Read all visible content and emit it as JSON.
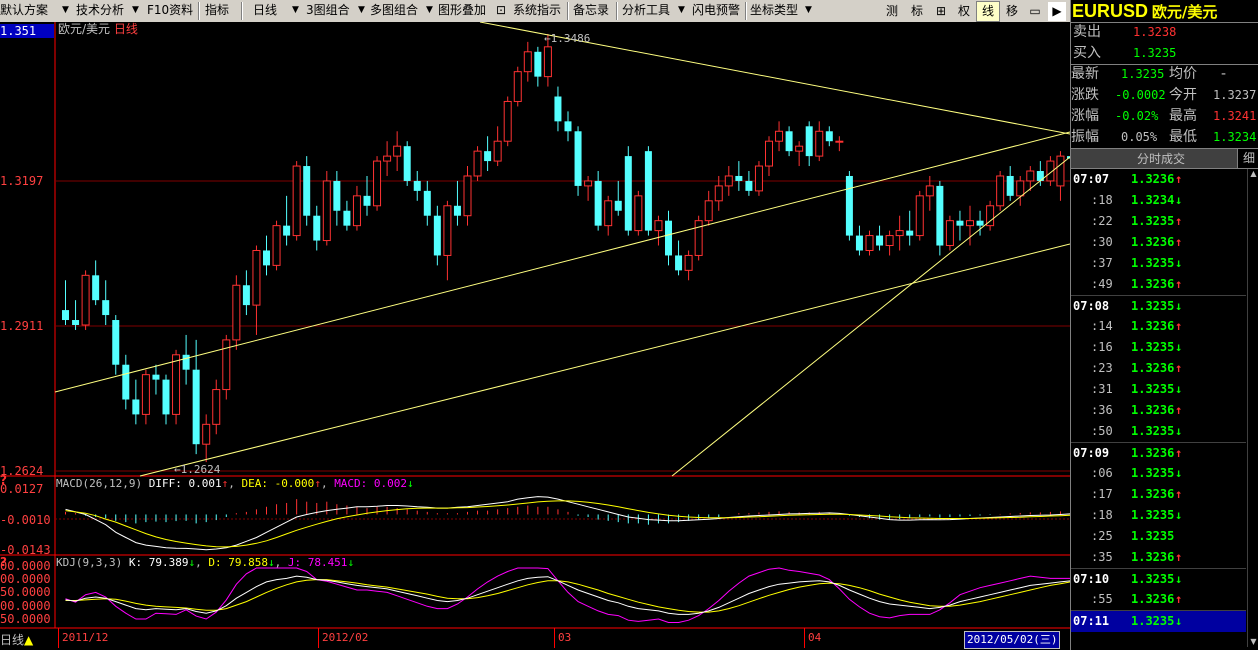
{
  "toolbar": {
    "items": [
      "默认方案",
      "技术分析",
      "F10资料",
      "指标",
      "日线",
      "3图组合",
      "多图组合",
      "图形叠加",
      "系统指示",
      "备忘录",
      "分析工具",
      "闪电预警",
      "坐标类型"
    ],
    "right_buttons": [
      "测",
      "标",
      "⊞",
      "权",
      "线",
      "移",
      "▭"
    ],
    "active_right": "线"
  },
  "chart": {
    "title": "欧元/美元",
    "period": "日线",
    "current_price_label": "1.351",
    "price_axis": [
      "1.3197",
      "1.2911",
      "1.2624"
    ],
    "high_annotation": "1.3486",
    "low_annotation": "1.2624",
    "macd_header": {
      "name": "MACD(26,12,9)",
      "diff": "DIFF: 0.001",
      "dea": "DEA: -0.000",
      "macd": "MACD: 0.002"
    },
    "macd_axis": [
      "0.0127",
      "-0.0010",
      "-0.0143"
    ],
    "kdj_header": {
      "name": "KDJ(9,3,3)",
      "k": "K: 79.389",
      "d": "D: 79.858",
      "j": "J: 78.451"
    },
    "kdj_axis": [
      "00.0000",
      "00.0000",
      "50.0000",
      "00.0000",
      "50.0000"
    ],
    "bottom_label": "日线",
    "date_labels": [
      "2011/12",
      "2012/02",
      "03",
      "04"
    ],
    "cursor_date": "2012/05/02(三)"
  },
  "quote": {
    "symbol": "EURUSD",
    "name": "欧元/美元",
    "sell_label": "卖出",
    "sell": "1.3238",
    "buy_label": "买入",
    "buy": "1.3235",
    "last_label": "最新",
    "last": "1.3235",
    "avg_label": "均价",
    "avg": "-",
    "chg_label": "涨跌",
    "chg": "-0.0002",
    "open_label": "今开",
    "open": "1.3237",
    "pct_label": "涨幅",
    "pct": "-0.02%",
    "high_label": "最高",
    "high": "1.3241",
    "amp_label": "振幅",
    "amp": "0.05%",
    "low_label": "最低",
    "low": "1.3234",
    "ticks_title": "分时成交",
    "detail_tab": "细",
    "ticks": [
      {
        "t": "07:07",
        "p": "1.3236",
        "d": "up"
      },
      {
        "t": ":18",
        "p": "1.3234",
        "d": "down"
      },
      {
        "t": ":22",
        "p": "1.3235",
        "d": "up"
      },
      {
        "t": ":30",
        "p": "1.3236",
        "d": "up"
      },
      {
        "t": ":37",
        "p": "1.3235",
        "d": "down"
      },
      {
        "t": ":49",
        "p": "1.3236",
        "d": "up"
      },
      {
        "t": "07:08",
        "p": "1.3235",
        "d": "down"
      },
      {
        "t": ":14",
        "p": "1.3236",
        "d": "up"
      },
      {
        "t": ":16",
        "p": "1.3235",
        "d": "down"
      },
      {
        "t": ":23",
        "p": "1.3236",
        "d": "up"
      },
      {
        "t": ":31",
        "p": "1.3235",
        "d": "down"
      },
      {
        "t": ":36",
        "p": "1.3236",
        "d": "up"
      },
      {
        "t": ":50",
        "p": "1.3235",
        "d": "down"
      },
      {
        "t": "07:09",
        "p": "1.3236",
        "d": "up"
      },
      {
        "t": ":06",
        "p": "1.3235",
        "d": "down"
      },
      {
        "t": ":17",
        "p": "1.3236",
        "d": "up"
      },
      {
        "t": ":18",
        "p": "1.3235",
        "d": "down"
      },
      {
        "t": ":25",
        "p": "1.3235",
        "d": ""
      },
      {
        "t": ":35",
        "p": "1.3236",
        "d": "up"
      },
      {
        "t": "07:10",
        "p": "1.3235",
        "d": "down"
      },
      {
        "t": ":55",
        "p": "1.3236",
        "d": "up"
      },
      {
        "t": "07:11",
        "p": "1.3235",
        "d": "down"
      }
    ]
  },
  "colors": {
    "up": "#ff3232",
    "down": "#54ffff",
    "text_green": "#00ff00",
    "axis_red": "#ff4040",
    "trend": "#ffff80",
    "diff": "#ffffff",
    "dea": "#ffff00",
    "macdc": "#ff00ff"
  },
  "candles": [
    {
      "o": 1.293,
      "h": 1.299,
      "l": 1.29,
      "c": 1.291
    },
    {
      "o": 1.291,
      "h": 1.295,
      "l": 1.289,
      "c": 1.29
    },
    {
      "o": 1.29,
      "h": 1.301,
      "l": 1.289,
      "c": 1.3
    },
    {
      "o": 1.3,
      "h": 1.303,
      "l": 1.294,
      "c": 1.295
    },
    {
      "o": 1.295,
      "h": 1.299,
      "l": 1.29,
      "c": 1.292
    },
    {
      "o": 1.291,
      "h": 1.292,
      "l": 1.28,
      "c": 1.282
    },
    {
      "o": 1.282,
      "h": 1.284,
      "l": 1.273,
      "c": 1.275
    },
    {
      "o": 1.275,
      "h": 1.279,
      "l": 1.27,
      "c": 1.272
    },
    {
      "o": 1.272,
      "h": 1.281,
      "l": 1.27,
      "c": 1.28
    },
    {
      "o": 1.28,
      "h": 1.282,
      "l": 1.276,
      "c": 1.279
    },
    {
      "o": 1.279,
      "h": 1.28,
      "l": 1.27,
      "c": 1.272
    },
    {
      "o": 1.272,
      "h": 1.285,
      "l": 1.27,
      "c": 1.284
    },
    {
      "o": 1.284,
      "h": 1.288,
      "l": 1.278,
      "c": 1.281
    },
    {
      "o": 1.281,
      "h": 1.287,
      "l": 1.264,
      "c": 1.266
    },
    {
      "o": 1.266,
      "h": 1.272,
      "l": 1.2624,
      "c": 1.27
    },
    {
      "o": 1.27,
      "h": 1.279,
      "l": 1.268,
      "c": 1.277
    },
    {
      "o": 1.277,
      "h": 1.288,
      "l": 1.275,
      "c": 1.287
    },
    {
      "o": 1.287,
      "h": 1.3,
      "l": 1.285,
      "c": 1.298
    },
    {
      "o": 1.298,
      "h": 1.301,
      "l": 1.292,
      "c": 1.294
    },
    {
      "o": 1.294,
      "h": 1.306,
      "l": 1.288,
      "c": 1.305
    },
    {
      "o": 1.305,
      "h": 1.308,
      "l": 1.3,
      "c": 1.302
    },
    {
      "o": 1.302,
      "h": 1.311,
      "l": 1.301,
      "c": 1.31
    },
    {
      "o": 1.31,
      "h": 1.316,
      "l": 1.306,
      "c": 1.308
    },
    {
      "o": 1.308,
      "h": 1.323,
      "l": 1.307,
      "c": 1.322
    },
    {
      "o": 1.322,
      "h": 1.324,
      "l": 1.31,
      "c": 1.312
    },
    {
      "o": 1.312,
      "h": 1.314,
      "l": 1.305,
      "c": 1.307
    },
    {
      "o": 1.307,
      "h": 1.321,
      "l": 1.306,
      "c": 1.319
    },
    {
      "o": 1.319,
      "h": 1.321,
      "l": 1.31,
      "c": 1.313
    },
    {
      "o": 1.313,
      "h": 1.315,
      "l": 1.309,
      "c": 1.31
    },
    {
      "o": 1.31,
      "h": 1.318,
      "l": 1.309,
      "c": 1.316
    },
    {
      "o": 1.316,
      "h": 1.32,
      "l": 1.312,
      "c": 1.314
    },
    {
      "o": 1.314,
      "h": 1.324,
      "l": 1.313,
      "c": 1.323
    },
    {
      "o": 1.323,
      "h": 1.327,
      "l": 1.32,
      "c": 1.324
    },
    {
      "o": 1.324,
      "h": 1.329,
      "l": 1.321,
      "c": 1.326
    },
    {
      "o": 1.326,
      "h": 1.327,
      "l": 1.318,
      "c": 1.319
    },
    {
      "o": 1.319,
      "h": 1.321,
      "l": 1.315,
      "c": 1.317
    },
    {
      "o": 1.317,
      "h": 1.319,
      "l": 1.31,
      "c": 1.312
    },
    {
      "o": 1.312,
      "h": 1.314,
      "l": 1.302,
      "c": 1.304
    },
    {
      "o": 1.304,
      "h": 1.315,
      "l": 1.299,
      "c": 1.314
    },
    {
      "o": 1.314,
      "h": 1.319,
      "l": 1.31,
      "c": 1.312
    },
    {
      "o": 1.312,
      "h": 1.322,
      "l": 1.31,
      "c": 1.32
    },
    {
      "o": 1.32,
      "h": 1.326,
      "l": 1.319,
      "c": 1.325
    },
    {
      "o": 1.325,
      "h": 1.328,
      "l": 1.321,
      "c": 1.323
    },
    {
      "o": 1.323,
      "h": 1.33,
      "l": 1.322,
      "c": 1.327
    },
    {
      "o": 1.327,
      "h": 1.336,
      "l": 1.326,
      "c": 1.335
    },
    {
      "o": 1.335,
      "h": 1.342,
      "l": 1.334,
      "c": 1.341
    },
    {
      "o": 1.341,
      "h": 1.347,
      "l": 1.339,
      "c": 1.345
    },
    {
      "o": 1.345,
      "h": 1.346,
      "l": 1.338,
      "c": 1.34
    },
    {
      "o": 1.34,
      "h": 1.3486,
      "l": 1.338,
      "c": 1.346
    },
    {
      "o": 1.336,
      "h": 1.338,
      "l": 1.329,
      "c": 1.331
    },
    {
      "o": 1.331,
      "h": 1.333,
      "l": 1.327,
      "c": 1.329
    },
    {
      "o": 1.329,
      "h": 1.33,
      "l": 1.316,
      "c": 1.318
    },
    {
      "o": 1.318,
      "h": 1.32,
      "l": 1.315,
      "c": 1.319
    },
    {
      "o": 1.319,
      "h": 1.321,
      "l": 1.309,
      "c": 1.31
    },
    {
      "o": 1.31,
      "h": 1.316,
      "l": 1.308,
      "c": 1.315
    },
    {
      "o": 1.315,
      "h": 1.319,
      "l": 1.312,
      "c": 1.313
    },
    {
      "o": 1.324,
      "h": 1.326,
      "l": 1.308,
      "c": 1.309
    },
    {
      "o": 1.309,
      "h": 1.317,
      "l": 1.308,
      "c": 1.316
    },
    {
      "o": 1.325,
      "h": 1.326,
      "l": 1.308,
      "c": 1.309
    },
    {
      "o": 1.309,
      "h": 1.312,
      "l": 1.306,
      "c": 1.311
    },
    {
      "o": 1.311,
      "h": 1.313,
      "l": 1.302,
      "c": 1.304
    },
    {
      "o": 1.304,
      "h": 1.307,
      "l": 1.3,
      "c": 1.301
    },
    {
      "o": 1.301,
      "h": 1.305,
      "l": 1.299,
      "c": 1.304
    },
    {
      "o": 1.304,
      "h": 1.312,
      "l": 1.303,
      "c": 1.311
    },
    {
      "o": 1.311,
      "h": 1.317,
      "l": 1.31,
      "c": 1.315
    },
    {
      "o": 1.315,
      "h": 1.32,
      "l": 1.313,
      "c": 1.318
    },
    {
      "o": 1.318,
      "h": 1.322,
      "l": 1.316,
      "c": 1.32
    },
    {
      "o": 1.32,
      "h": 1.323,
      "l": 1.317,
      "c": 1.319
    },
    {
      "o": 1.319,
      "h": 1.321,
      "l": 1.316,
      "c": 1.317
    },
    {
      "o": 1.317,
      "h": 1.323,
      "l": 1.316,
      "c": 1.322
    },
    {
      "o": 1.322,
      "h": 1.328,
      "l": 1.32,
      "c": 1.327
    },
    {
      "o": 1.327,
      "h": 1.331,
      "l": 1.325,
      "c": 1.329
    },
    {
      "o": 1.329,
      "h": 1.33,
      "l": 1.324,
      "c": 1.325
    },
    {
      "o": 1.325,
      "h": 1.327,
      "l": 1.322,
      "c": 1.326
    },
    {
      "o": 1.33,
      "h": 1.331,
      "l": 1.322,
      "c": 1.324
    },
    {
      "o": 1.324,
      "h": 1.331,
      "l": 1.323,
      "c": 1.329
    },
    {
      "o": 1.329,
      "h": 1.33,
      "l": 1.326,
      "c": 1.327
    },
    {
      "o": 1.327,
      "h": 1.328,
      "l": 1.325,
      "c": 1.327
    },
    {
      "o": 1.32,
      "h": 1.321,
      "l": 1.307,
      "c": 1.308
    },
    {
      "o": 1.308,
      "h": 1.31,
      "l": 1.304,
      "c": 1.305
    },
    {
      "o": 1.305,
      "h": 1.309,
      "l": 1.304,
      "c": 1.308
    },
    {
      "o": 1.308,
      "h": 1.31,
      "l": 1.305,
      "c": 1.306
    },
    {
      "o": 1.306,
      "h": 1.309,
      "l": 1.304,
      "c": 1.308
    },
    {
      "o": 1.308,
      "h": 1.312,
      "l": 1.305,
      "c": 1.309
    },
    {
      "o": 1.309,
      "h": 1.313,
      "l": 1.306,
      "c": 1.308
    },
    {
      "o": 1.308,
      "h": 1.317,
      "l": 1.307,
      "c": 1.316
    },
    {
      "o": 1.316,
      "h": 1.32,
      "l": 1.313,
      "c": 1.318
    },
    {
      "o": 1.318,
      "h": 1.319,
      "l": 1.304,
      "c": 1.306
    },
    {
      "o": 1.306,
      "h": 1.312,
      "l": 1.305,
      "c": 1.311
    },
    {
      "o": 1.311,
      "h": 1.313,
      "l": 1.307,
      "c": 1.31
    },
    {
      "o": 1.31,
      "h": 1.314,
      "l": 1.306,
      "c": 1.311
    },
    {
      "o": 1.311,
      "h": 1.313,
      "l": 1.308,
      "c": 1.31
    },
    {
      "o": 1.31,
      "h": 1.315,
      "l": 1.309,
      "c": 1.314
    },
    {
      "o": 1.314,
      "h": 1.321,
      "l": 1.313,
      "c": 1.32
    },
    {
      "o": 1.32,
      "h": 1.322,
      "l": 1.315,
      "c": 1.316
    },
    {
      "o": 1.316,
      "h": 1.32,
      "l": 1.314,
      "c": 1.319
    },
    {
      "o": 1.319,
      "h": 1.322,
      "l": 1.317,
      "c": 1.321
    },
    {
      "o": 1.321,
      "h": 1.323,
      "l": 1.318,
      "c": 1.319
    },
    {
      "o": 1.319,
      "h": 1.324,
      "l": 1.318,
      "c": 1.323
    },
    {
      "o": 1.318,
      "h": 1.325,
      "l": 1.315,
      "c": 1.324
    },
    {
      "o": 1.324,
      "h": 1.326,
      "l": 1.322,
      "c": 1.3235
    },
    {
      "o": 1.3235,
      "h": 1.326,
      "l": 1.32,
      "c": 1.3236
    },
    {
      "o": 1.3236,
      "h": 1.3241,
      "l": 1.3234,
      "c": 1.3235
    }
  ],
  "macd_hist": [
    0.001,
    0.0005,
    -0.0005,
    -0.001,
    -0.0015,
    -0.0025,
    -0.003,
    -0.0035,
    -0.003,
    -0.0028,
    -0.003,
    -0.0026,
    -0.0025,
    -0.0035,
    -0.003,
    -0.0022,
    -0.001,
    0.0005,
    0.001,
    0.002,
    0.003,
    0.004,
    0.0045,
    0.006,
    0.005,
    0.0045,
    0.005,
    0.004,
    0.0035,
    0.003,
    0.0025,
    0.003,
    0.003,
    0.0025,
    0.002,
    0.0015,
    0.001,
    0.0005,
    0.0005,
    0.0005,
    0.001,
    0.0015,
    0.0015,
    0.002,
    0.0025,
    0.003,
    0.0035,
    0.003,
    0.003,
    0.002,
    0.001,
    -0.0005,
    -0.001,
    -0.002,
    -0.0025,
    -0.003,
    -0.0035,
    -0.0035,
    -0.004,
    -0.0035,
    -0.0035,
    -0.003,
    -0.0025,
    -0.002,
    -0.0015,
    -0.001,
    0.0,
    0.0005,
    0.0005,
    0.0008,
    0.001,
    0.0012,
    0.001,
    0.0008,
    0.0008,
    0.001,
    0.0008,
    0.0005,
    -0.0005,
    -0.001,
    -0.0015,
    -0.002,
    -0.002,
    -0.0018,
    -0.0015,
    -0.001,
    -0.0008,
    -0.0012,
    -0.001,
    -0.0008,
    -0.0006,
    -0.0004,
    -0.0002,
    0.0002,
    0.0004,
    0.0006,
    0.0008,
    0.0008,
    0.001,
    0.0012,
    0.0012,
    0.0015,
    0.0014
  ],
  "macd_diff": [
    0.002,
    0.001,
    0.0,
    -0.002,
    -0.004,
    -0.007,
    -0.009,
    -0.011,
    -0.012,
    -0.0125,
    -0.013,
    -0.0132,
    -0.0133,
    -0.0135,
    -0.0138,
    -0.0135,
    -0.013,
    -0.012,
    -0.0105,
    -0.009,
    -0.007,
    -0.005,
    -0.003,
    -0.001,
    0.0,
    0.0008,
    0.0015,
    0.002,
    0.0025,
    0.003,
    0.003,
    0.0032,
    0.0035,
    0.0035,
    0.0033,
    0.003,
    0.0028,
    0.0025,
    0.0025,
    0.0028,
    0.003,
    0.0035,
    0.004,
    0.0045,
    0.005,
    0.006,
    0.0065,
    0.007,
    0.0068,
    0.006,
    0.005,
    0.004,
    0.003,
    0.002,
    0.001,
    0.0,
    -0.001,
    -0.0015,
    -0.002,
    -0.0022,
    -0.0025,
    -0.0025,
    -0.0023,
    -0.0021,
    -0.0019,
    -0.0016,
    -0.0012,
    -0.0009,
    -0.0006,
    -0.0004,
    -0.0002,
    0.0,
    0.0002,
    0.0003,
    0.0004,
    0.0005,
    0.0006,
    0.0004,
    0.0,
    -0.0005,
    -0.001,
    -0.0015,
    -0.002,
    -0.0022,
    -0.0022,
    -0.0021,
    -0.002,
    -0.0021,
    -0.002,
    -0.0018,
    -0.0016,
    -0.0014,
    -0.0012,
    -0.001,
    -0.0008,
    -0.0006,
    -0.0004,
    -0.0003,
    -0.0002,
    0.0,
    0.0002,
    0.0005,
    0.0008
  ],
  "macd_dea": [
    0.0015,
    0.001,
    0.0005,
    -0.0005,
    -0.0018,
    -0.003,
    -0.0045,
    -0.006,
    -0.0075,
    -0.0088,
    -0.0098,
    -0.0106,
    -0.0112,
    -0.0118,
    -0.0123,
    -0.0126,
    -0.0127,
    -0.0125,
    -0.012,
    -0.0113,
    -0.0103,
    -0.009,
    -0.0076,
    -0.0062,
    -0.005,
    -0.0038,
    -0.0027,
    -0.0017,
    -0.0009,
    -0.0002,
    0.0005,
    0.001,
    0.0015,
    0.0019,
    0.0022,
    0.0024,
    0.0025,
    0.0025,
    0.0025,
    0.0026,
    0.0027,
    0.0029,
    0.0031,
    0.0034,
    0.0037,
    0.0041,
    0.0045,
    0.0049,
    0.0052,
    0.0053,
    0.0053,
    0.0051,
    0.0048,
    0.0043,
    0.0037,
    0.003,
    0.0022,
    0.0015,
    0.0008,
    0.0002,
    -0.0003,
    -0.0007,
    -0.001,
    -0.0012,
    -0.0013,
    -0.0013,
    -0.0013,
    -0.0012,
    -0.001,
    -0.0009,
    -0.0007,
    -0.0005,
    -0.0003,
    -0.0002,
    -0.0001,
    0.0,
    0.0001,
    0.0001,
    0.0,
    -0.0002,
    -0.0004,
    -0.0006,
    -0.0009,
    -0.0011,
    -0.0013,
    -0.0014,
    -0.0015,
    -0.0016,
    -0.0016,
    -0.0016,
    -0.0016,
    -0.0015,
    -0.0014,
    -0.0013,
    -0.0012,
    -0.0011,
    -0.0009,
    -0.0008,
    -0.0006,
    -0.0005,
    -0.0003,
    -0.0001,
    0.0001
  ],
  "kdj_k": [
    45,
    43,
    48,
    50,
    48,
    42,
    36,
    30,
    28,
    30,
    29,
    28,
    30,
    25,
    22,
    26,
    35,
    48,
    58,
    68,
    76,
    80,
    82,
    86,
    84,
    80,
    79,
    76,
    73,
    70,
    68,
    66,
    64,
    60,
    56,
    52,
    48,
    44,
    42,
    44,
    48,
    54,
    60,
    66,
    72,
    78,
    82,
    84,
    85,
    78,
    70,
    62,
    56,
    50,
    44,
    40,
    34,
    30,
    28,
    26,
    22,
    20,
    20,
    22,
    26,
    32,
    40,
    48,
    56,
    62,
    68,
    72,
    74,
    76,
    77,
    78,
    76,
    70,
    62,
    55,
    48,
    42,
    38,
    36,
    34,
    32,
    30,
    32,
    36,
    42,
    46,
    50,
    54,
    58,
    62,
    66,
    70,
    72,
    74,
    76,
    78,
    79,
    79
  ],
  "kdj_d": [
    44,
    44,
    45,
    46,
    47,
    46,
    43,
    39,
    36,
    34,
    33,
    32,
    31,
    29,
    27,
    27,
    30,
    36,
    42,
    50,
    58,
    65,
    71,
    76,
    79,
    80,
    80,
    78,
    76,
    74,
    71,
    69,
    67,
    64,
    61,
    58,
    55,
    51,
    48,
    47,
    47,
    49,
    52,
    56,
    61,
    66,
    71,
    75,
    78,
    78,
    76,
    72,
    67,
    62,
    56,
    51,
    46,
    41,
    37,
    33,
    30,
    27,
    25,
    24,
    24,
    26,
    30,
    35,
    41,
    47,
    53,
    58,
    63,
    67,
    70,
    73,
    74,
    73,
    70,
    66,
    61,
    55,
    50,
    45,
    41,
    38,
    35,
    34,
    34,
    36,
    39,
    42,
    46,
    50,
    54,
    58,
    62,
    66,
    70,
    73,
    76,
    78,
    79
  ],
  "kdj_j": [
    47,
    41,
    54,
    58,
    50,
    34,
    22,
    12,
    12,
    22,
    21,
    20,
    28,
    17,
    12,
    24,
    45,
    72,
    90,
    100,
    100,
    100,
    100,
    100,
    94,
    80,
    77,
    72,
    67,
    62,
    62,
    60,
    58,
    52,
    46,
    40,
    34,
    30,
    30,
    38,
    50,
    64,
    76,
    86,
    94,
    100,
    100,
    100,
    99,
    78,
    58,
    42,
    34,
    26,
    20,
    18,
    10,
    8,
    10,
    12,
    6,
    6,
    10,
    18,
    30,
    44,
    60,
    74,
    86,
    92,
    98,
    100,
    96,
    94,
    91,
    88,
    80,
    64,
    46,
    33,
    22,
    16,
    14,
    18,
    20,
    20,
    20,
    28,
    40,
    54,
    60,
    66,
    70,
    74,
    78,
    82,
    86,
    84,
    82,
    82,
    82,
    81,
    78
  ]
}
